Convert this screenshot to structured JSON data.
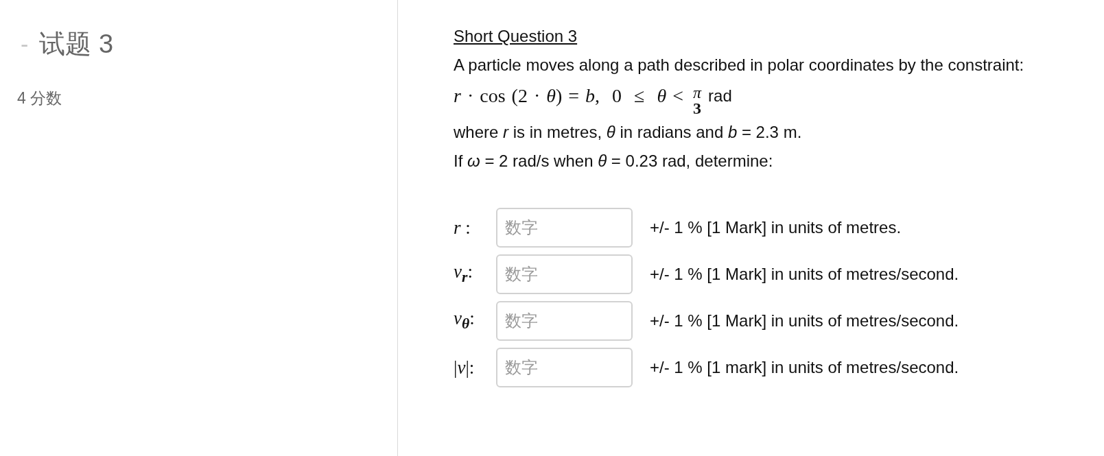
{
  "sidebar": {
    "toggle": "-",
    "title": "试题 3",
    "points": "4 分数"
  },
  "question": {
    "heading": "Short Question 3",
    "intro": "A particle moves along a path described in polar coordinates by the constraint:",
    "constraint": {
      "expression": "*r* · cos (2 · *θ*) = *b*,  0  ≤  *θ* <",
      "fraction": {
        "numerator": "π",
        "denominator": "3"
      },
      "unit": "rad"
    },
    "where": "where *r* is in metres, *θ* in radians and *b* = 2.3 m.",
    "condition": "If *ω* = 2 rad/s when *θ* = 0.23 rad, determine:"
  },
  "answers": [
    {
      "label": "*r* :",
      "placeholder": "数字",
      "note": "+/- 1 % [1 Mark] in units of metres."
    },
    {
      "label": "*v*$_{r}$:",
      "placeholder": "数字",
      "note": "+/- 1 % [1 Mark] in units of metres/second."
    },
    {
      "label": "*v*$_{θ}$:",
      "placeholder": "数字",
      "note": "+/- 1 % [1 Mark] in units of metres/second."
    },
    {
      "label": "|*v*|:",
      "placeholder": "数字",
      "note": "+/- 1 % [1 mark] in units of metres/second."
    }
  ]
}
